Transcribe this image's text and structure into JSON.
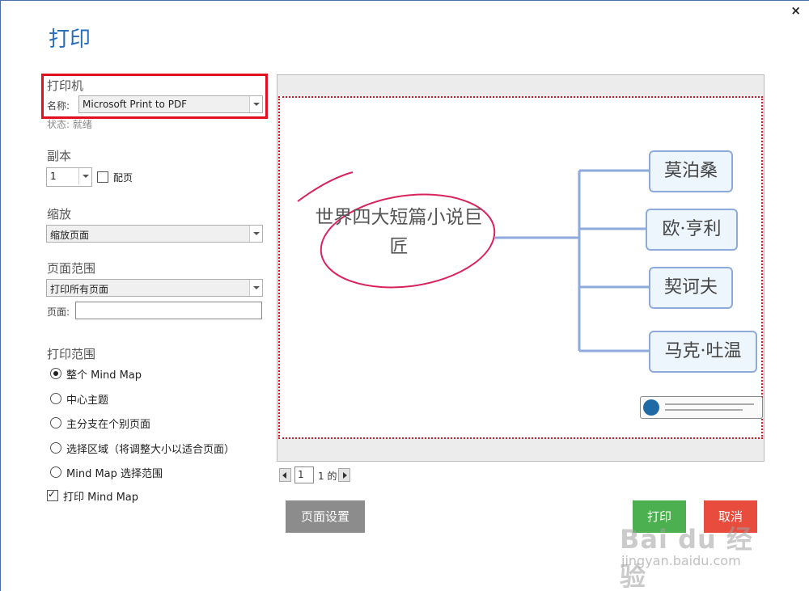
{
  "dialog": {
    "title": "打印",
    "close_glyph": "×"
  },
  "printer": {
    "section_label": "打印机",
    "name_label": "名称:",
    "name_value": "Microsoft Print to PDF",
    "status_label": "状态:",
    "status_value": "就绪"
  },
  "copies": {
    "section_label": "副本",
    "count_value": "1",
    "collate_label": "配页",
    "collate_checked": false
  },
  "scale": {
    "section_label": "缩放",
    "value": "缩放页面"
  },
  "page_range": {
    "section_label": "页面范围",
    "value": "打印所有页面",
    "pages_label": "页面:",
    "pages_value": ""
  },
  "print_scope": {
    "section_label": "打印范围",
    "options": [
      {
        "label": "整个 Mind Map",
        "selected": true
      },
      {
        "label": "中心主题",
        "selected": false
      },
      {
        "label": "主分支在个别页面",
        "selected": false
      },
      {
        "label": "选择区域（将调整大小以适合页面）",
        "selected": false
      },
      {
        "label": "Mind Map 选择范围",
        "selected": false
      }
    ],
    "print_mindmap_label": "打印 Mind Map",
    "print_mindmap_checked": true
  },
  "preview": {
    "central_topic_line1": "世界四大短篇小说巨",
    "central_topic_line2": "匠",
    "branches": [
      "莫泊桑",
      "欧·亨利",
      "契诃夫",
      "马克·吐温"
    ],
    "accent_color": "#e0101e",
    "branch_color": "#8eaadb"
  },
  "pager": {
    "current_page": "1",
    "of_text": "1 的"
  },
  "buttons": {
    "page_setup": "页面设置",
    "print": "打印",
    "cancel": "取消"
  },
  "watermark": {
    "brand": "Bai du 经验",
    "url": "jingyan.baidu.com"
  }
}
